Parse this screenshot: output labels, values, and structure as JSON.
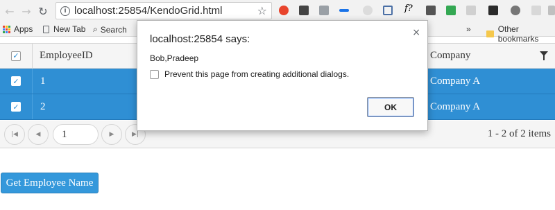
{
  "browser": {
    "url": "localhost:25854/KendoGrid.html",
    "extensions_overflow": "»"
  },
  "bookmarks": {
    "apps": "Apps",
    "new_tab": "New Tab",
    "search": "Search",
    "other": "Other bookmarks"
  },
  "grid": {
    "columns": [
      "EmployeeID",
      "Company"
    ],
    "rows": [
      {
        "id": "1",
        "company": "Company A",
        "selected": true
      },
      {
        "id": "2",
        "company": "Company A",
        "selected": true
      }
    ],
    "pager": {
      "page": "1",
      "info": "1 - 2 of 2 items"
    }
  },
  "button": {
    "label": "Get Employee Name"
  },
  "dialog": {
    "title": "localhost:25854 says:",
    "message": "Bob,Pradeep",
    "checkbox_label": "Prevent this page from creating additional dialogs.",
    "ok_label": "OK",
    "close_glyph": "×"
  },
  "colors": {
    "selected_row": "#2f8fd4",
    "primary_button": "#3498db"
  }
}
